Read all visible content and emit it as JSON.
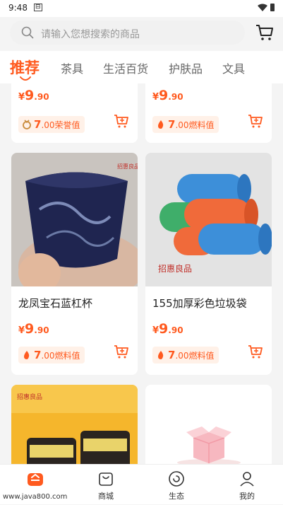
{
  "status": {
    "time": "9:48",
    "sim": "⊟"
  },
  "search": {
    "placeholder": "请输入您想搜索的商品"
  },
  "tabs": [
    {
      "label": "推荐"
    },
    {
      "label": "茶具"
    },
    {
      "label": "生活百货"
    },
    {
      "label": "护肤品"
    },
    {
      "label": "文具"
    }
  ],
  "products_top": [
    {
      "currency": "¥",
      "price_int": "9",
      "price_dec": ".90",
      "badge_num": "7",
      "badge_dec": ".00",
      "badge_label": "荣誉值",
      "badge_icon": "medal-icon"
    },
    {
      "currency": "¥",
      "price_int": "9",
      "price_dec": ".90",
      "badge_num": "7",
      "badge_dec": ".00",
      "badge_label": "燃料值",
      "badge_icon": "flame-icon"
    }
  ],
  "products_mid": [
    {
      "title": "龙凤宝石蓝杠杯",
      "currency": "¥",
      "price_int": "9",
      "price_dec": ".90",
      "badge_num": "7",
      "badge_dec": ".00",
      "badge_label": "燃料值",
      "brand": "招惠良品"
    },
    {
      "title": "155加厚彩色垃圾袋",
      "currency": "¥",
      "price_int": "9",
      "price_dec": ".90",
      "badge_num": "7",
      "badge_dec": ".00",
      "badge_label": "燃料值",
      "brand": "招惠良品"
    }
  ],
  "products_bottom": [
    {
      "brand": "招惠良品"
    }
  ],
  "nav": [
    {
      "label": ""
    },
    {
      "label": "商城"
    },
    {
      "label": "生态"
    },
    {
      "label": "我的"
    }
  ],
  "watermark": "www.java800.com",
  "colors": {
    "accent": "#ff5a1f",
    "badge_bg": "#fff1e8"
  }
}
